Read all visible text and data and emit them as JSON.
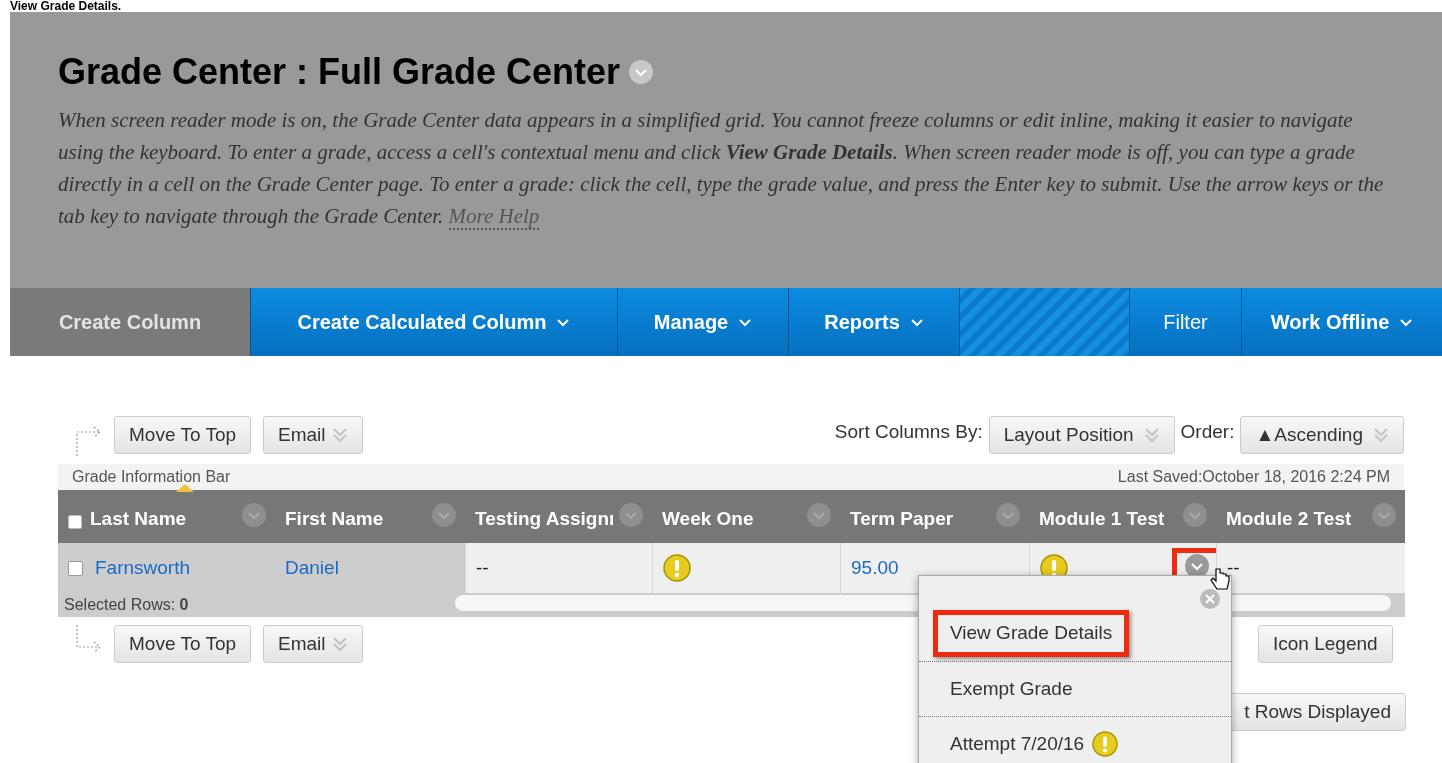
{
  "caption": "View Grade Details.",
  "page": {
    "title": "Grade Center : Full Grade Center",
    "description": "When screen reader mode is on, the Grade Center data appears in a simplified grid. You cannot freeze columns or edit inline, making it easier to navigate using the keyboard. To enter a grade, access a cell's contextual menu and click **View Grade Details**. When screen reader mode is off, you can type a grade directly in a cell on the Grade Center page. To enter a grade: click the cell, type the grade value, and press the Enter key to submit. Use the arrow keys or the tab key to navigate through the Grade Center.",
    "help_link": "More Help"
  },
  "nav": [
    {
      "kind": "plain",
      "label": "Create Column"
    },
    {
      "kind": "menu",
      "label": "Create Calculated Column"
    },
    {
      "kind": "menu",
      "label": "Manage"
    },
    {
      "kind": "menu",
      "label": "Reports"
    },
    {
      "kind": "blank"
    },
    {
      "kind": "button",
      "label": "Filter"
    },
    {
      "kind": "menu",
      "label": "Work Offline"
    }
  ],
  "toolbar_top": {
    "buttons": [
      {
        "label": "Move To Top",
        "dropdown": false
      },
      {
        "label": "Email",
        "dropdown": true
      }
    ],
    "sort_label": "Sort Columns By:",
    "sort_value": "Layout Position",
    "order_label": "Order:",
    "order_value": "▲Ascending"
  },
  "info_bar": {
    "label": "Grade Information Bar",
    "saved": "Last Saved:October 18, 2016 2:24 PM"
  },
  "table": {
    "all_checked": false,
    "columns": [
      "Last Name",
      "First Name",
      "Testing Assignı",
      "Week One",
      "Term Paper",
      "Module 1 Test",
      "Module 2 Test"
    ],
    "rows": [
      {
        "checked": false,
        "cells": [
          {
            "kind": "link",
            "text": "Farnsworth"
          },
          {
            "kind": "link",
            "text": "Daniel"
          },
          {
            "kind": "text",
            "text": "--"
          },
          {
            "kind": "alert"
          },
          {
            "kind": "link",
            "text": "95.00"
          },
          {
            "kind": "alert",
            "menu_button_highlighted": true
          },
          {
            "kind": "text",
            "text": "--"
          }
        ]
      }
    ],
    "selected_rows_label": "Selected Rows:",
    "selected_rows_count": "0"
  },
  "toolbar_bottom": {
    "buttons": [
      {
        "label": "Move To Top",
        "dropdown": false
      },
      {
        "label": "Email",
        "dropdown": true
      }
    ],
    "right_buttons": [
      "Icon Legend",
      "t Rows Displayed"
    ]
  },
  "context_menu": [
    {
      "kind": "text",
      "label": "View Grade Details",
      "highlighted": true
    },
    {
      "kind": "text",
      "label": "Exempt Grade",
      "highlighted": false
    },
    {
      "kind": "alert",
      "label": "Attempt 7/20/16",
      "highlighted": false
    }
  ]
}
